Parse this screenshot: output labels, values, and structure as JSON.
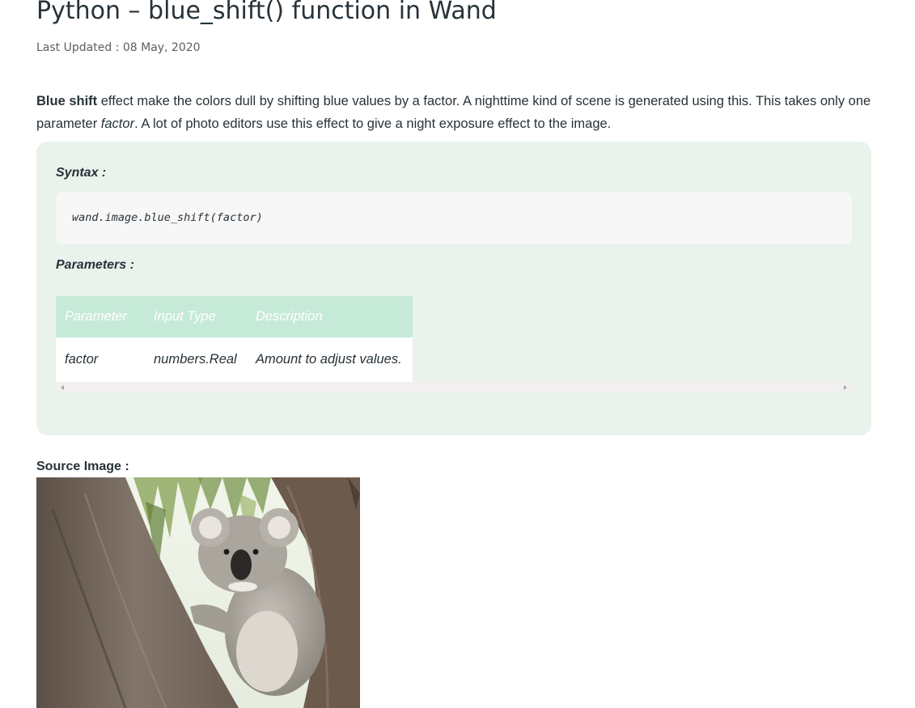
{
  "article": {
    "title": "Python – blue_shift() function in Wand",
    "last_updated": "Last Updated : 08 May, 2020",
    "intro": {
      "term": "Blue shift",
      "text_before_param": " effect make the colors dull by shifting blue values by a factor. A nighttime kind of scene is generated using this. This takes only one parameter ",
      "param": "factor",
      "text_after_param": ". A lot of photo editors use this effect to give a night exposure effect to the image."
    }
  },
  "syntax_panel": {
    "syntax_heading": "Syntax :",
    "code": "wand.image.blue_shift(factor)",
    "parameters_heading": "Parameters :",
    "table": {
      "headers": [
        "Parameter",
        "Input Type",
        "Description"
      ],
      "rows": [
        [
          "factor",
          "numbers.Real",
          "Amount to adjust values."
        ]
      ]
    }
  },
  "source": {
    "label": "Source Image :",
    "image_icon": "koala-photo"
  },
  "colors": {
    "panel_background": "#e9f2eb",
    "table_header_background": "#c6ead8",
    "code_background": "#f7f7f7",
    "text": "#273239"
  }
}
